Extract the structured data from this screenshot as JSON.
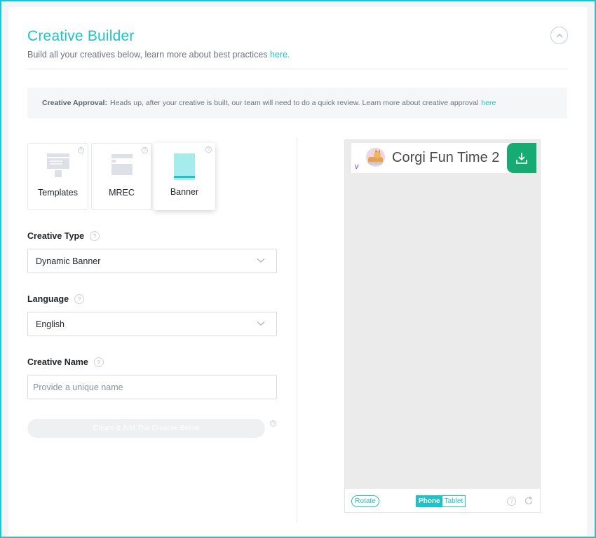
{
  "header": {
    "title": "Creative Builder",
    "subtitle": "Build all your creatives below, learn more about best practices",
    "subtitle_link": "here."
  },
  "notice": {
    "label": "Creative Approval:",
    "text": "Heads up, after your creative is built, our team will need to do a quick review. Learn more about creative approval",
    "link": "here"
  },
  "tiles": [
    {
      "label": "Templates",
      "icon": "template-layout-icon",
      "active": false
    },
    {
      "label": "MREC",
      "icon": "mrec-layout-icon",
      "active": false
    },
    {
      "label": "Banner",
      "icon": "banner-layout-icon",
      "active": true
    }
  ],
  "form": {
    "creative_type": {
      "label": "Creative Type",
      "value": "Dynamic Banner"
    },
    "language": {
      "label": "Language",
      "value": "English"
    },
    "creative_name": {
      "label": "Creative Name",
      "placeholder": "Provide a unique name",
      "value": ""
    },
    "create_button": "Create & Add This Creative Below",
    "help_glyph": "?"
  },
  "preview": {
    "app_title": "Corgi Fun Time 2",
    "ad_mark": "V",
    "rotate_label": "Rotate",
    "device_options": [
      "Phone",
      "Tablet"
    ],
    "selected_device": "Phone"
  },
  "colors": {
    "accent": "#1ec3c7",
    "download_button": "#17ab73",
    "screen_background": "#ebebeb"
  }
}
